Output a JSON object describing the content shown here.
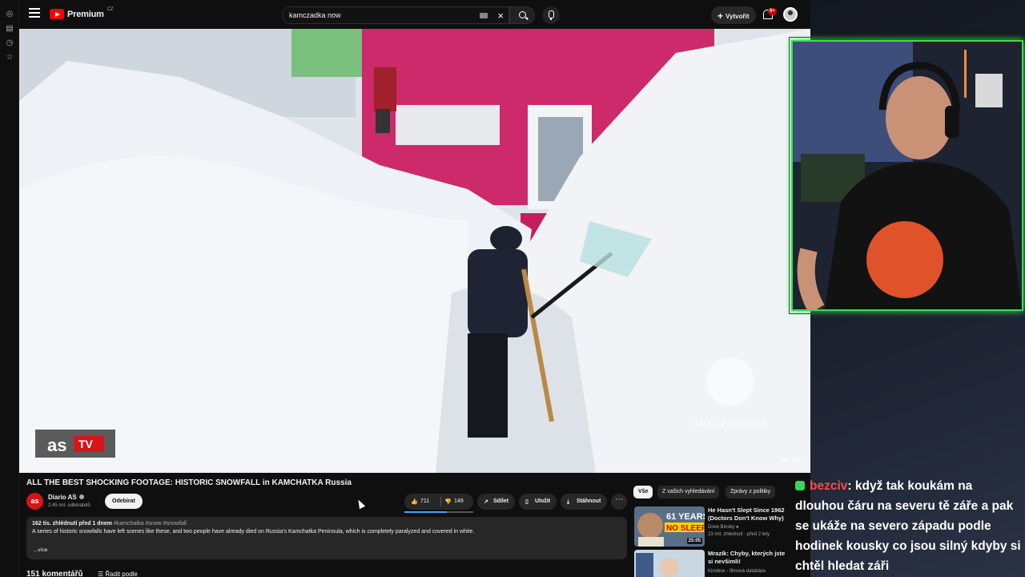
{
  "header": {
    "brand": "Premium",
    "country": "CZ",
    "search_value": "kamczadka now",
    "create_label": "Vytvořit",
    "notifications_badge": "9+"
  },
  "video": {
    "watermark_channel": "asTV",
    "watermark_agency": "МЧС РОССИИ",
    "corner_logo": "as TV"
  },
  "info": {
    "title": "ALL THE BEST SHOCKING FOOTAGE: HISTORIC SNOWFALL in KAMCHATKA Russia",
    "channel_avatar": "as",
    "channel_name": "Diario AS",
    "channel_subs": "2,45 mil. odběratelů",
    "subscribe_label": "Odebírat",
    "likes": "711",
    "dislikes": "149",
    "like_ratio": 0.62,
    "share_label": "Sdílet",
    "save_label": "Uložit",
    "download_label": "Stáhnout",
    "more_label": "⋯"
  },
  "description": {
    "stats": "162 tis. zhlédnutí  před 1 dnem",
    "tags": "#kamchatka #snow #snowfall",
    "text": "A series of historic snowfalls have left scenes like these, and two people have already died on Russia's Kamchatka Peninsula, which is completely paralyzed and covered in white.",
    "more": "...více"
  },
  "comments": {
    "count_label": "151 komentářů",
    "sort_label": "Řadit podle"
  },
  "related": {
    "chips": [
      "Vše",
      "Z vašich vyhledávání",
      "Zprávy z politiky"
    ],
    "items": [
      {
        "title": "He Hasn't Slept Since 1962 (Doctors Don't Know Why)",
        "channel": "Drew Binsky",
        "meta": "23 mil. zhlédnutí · před 2 lety",
        "duration": "25:05",
        "thumb_text_1": "61 YEARS",
        "thumb_text_2": "NO SLEEP"
      },
      {
        "title": "Mrazík: Chyby, kterých jste si nevšimli!",
        "channel": "Kinobox - filmová databáze",
        "meta": "",
        "duration": ""
      }
    ]
  },
  "chat": {
    "user": "bezciv",
    "message": ": když tak koukám na dlouhou čáru na severu tě záře a pak se ukáže na severo západu podle hodinek kousky co jsou silný kdyby si chtěl hledat záři"
  },
  "colors": {
    "accent_red": "#ff0000",
    "webcam_border": "#36e04a",
    "chat_user": "#ff4a4a",
    "like_bar": "#3ea6ff"
  }
}
